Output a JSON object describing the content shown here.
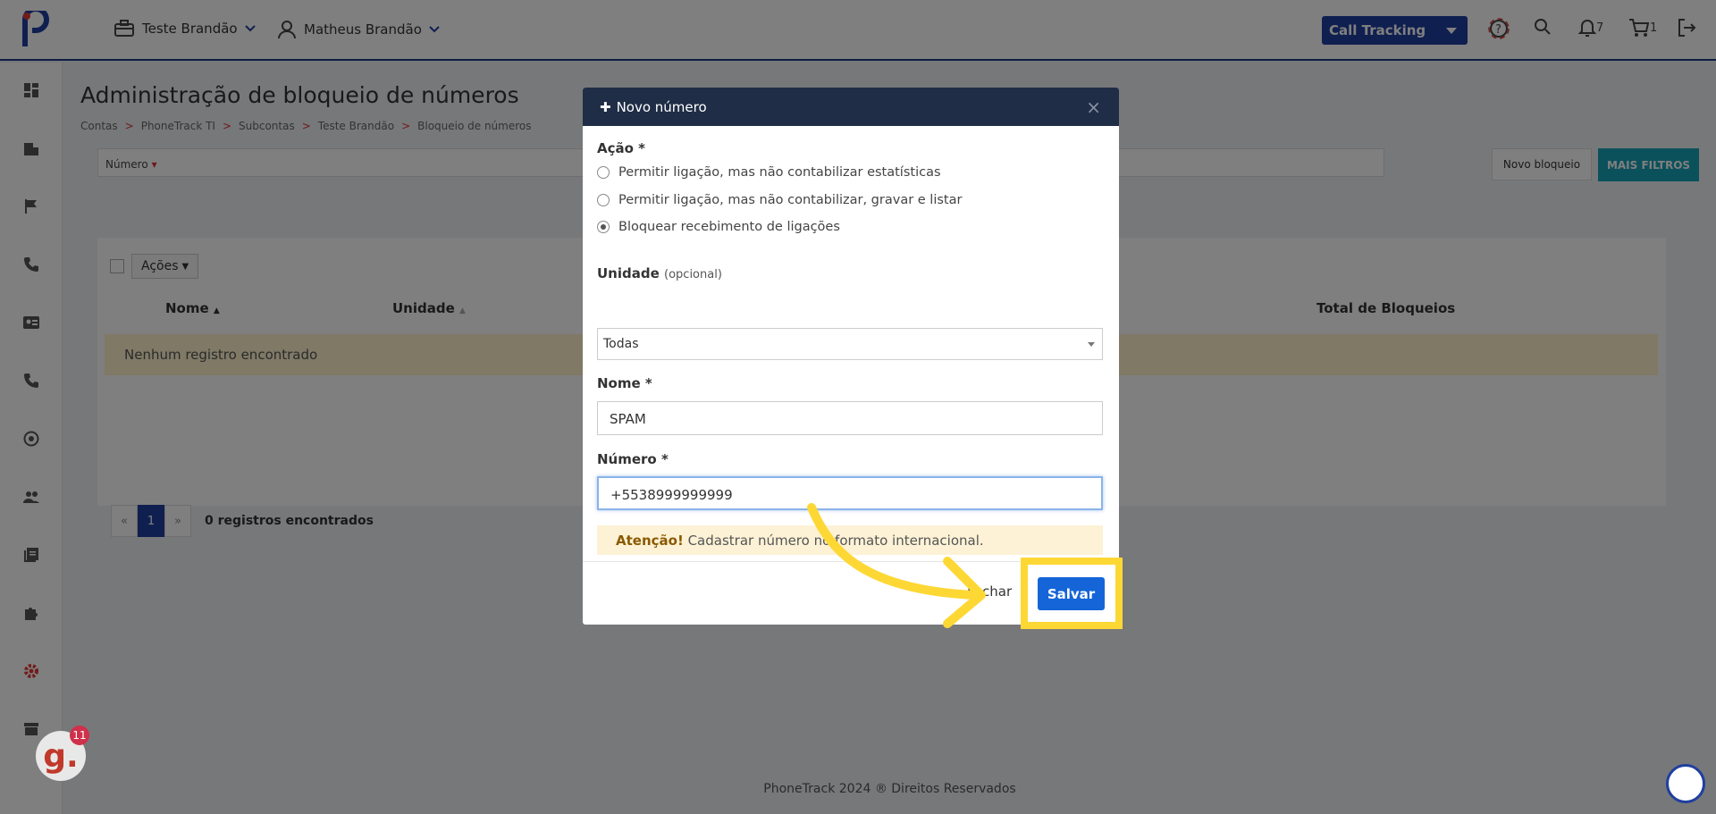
{
  "topbar": {
    "account": "Teste Brandão",
    "user": "Matheus Brandão",
    "product_select": "Call Tracking",
    "notifications_count": "7",
    "cart_count": "1"
  },
  "page": {
    "title": "Administração de bloqueio de números",
    "breadcrumb": [
      "Contas",
      "PhoneTrack TI",
      "Subcontas",
      "Teste Brandão",
      "Bloqueio de números"
    ],
    "breadcrumb_sep": ">"
  },
  "filters": {
    "numero_label": "Número",
    "novo_bloqueio": "Novo bloqueio",
    "mais_filtros": "MAIS FILTROS"
  },
  "table": {
    "acoes_label": "Ações",
    "columns": [
      "Nome",
      "Unidade",
      "Total de Bloqueios"
    ],
    "empty_text": "Nenhum registro encontrado"
  },
  "pager": {
    "prev": "«",
    "current": "1",
    "next": "»",
    "summary": "0 registros encontrados"
  },
  "footer": {
    "text": "PhoneTrack 2024 ® Direitos Reservados"
  },
  "modal": {
    "title": "Novo número",
    "close": "×",
    "acao_label": "Ação *",
    "acao_options": [
      "Permitir ligação, mas não contabilizar estatísticas",
      "Permitir ligação, mas não contabilizar, gravar e listar",
      "Bloquear recebimento de ligações"
    ],
    "acao_selected": 2,
    "unidade_label": "Unidade",
    "unidade_optional": "(opcional)",
    "unidade_value": "Todas",
    "nome_label": "Nome *",
    "nome_value": "SPAM",
    "numero_label": "Número *",
    "numero_value": "+5538999999999",
    "alert_strong": "Atenção!",
    "alert_text": "Cadastrar número no formato internacional.",
    "fechar": "Fechar",
    "salvar": "Salvar"
  },
  "widgets": {
    "g_badge_letter": "g.",
    "g_badge_count": "11"
  },
  "colors": {
    "brand": "#1f3fa0",
    "highlight": "#fdd835",
    "save": "#1565d8",
    "accent_teal": "#17a2b8"
  }
}
